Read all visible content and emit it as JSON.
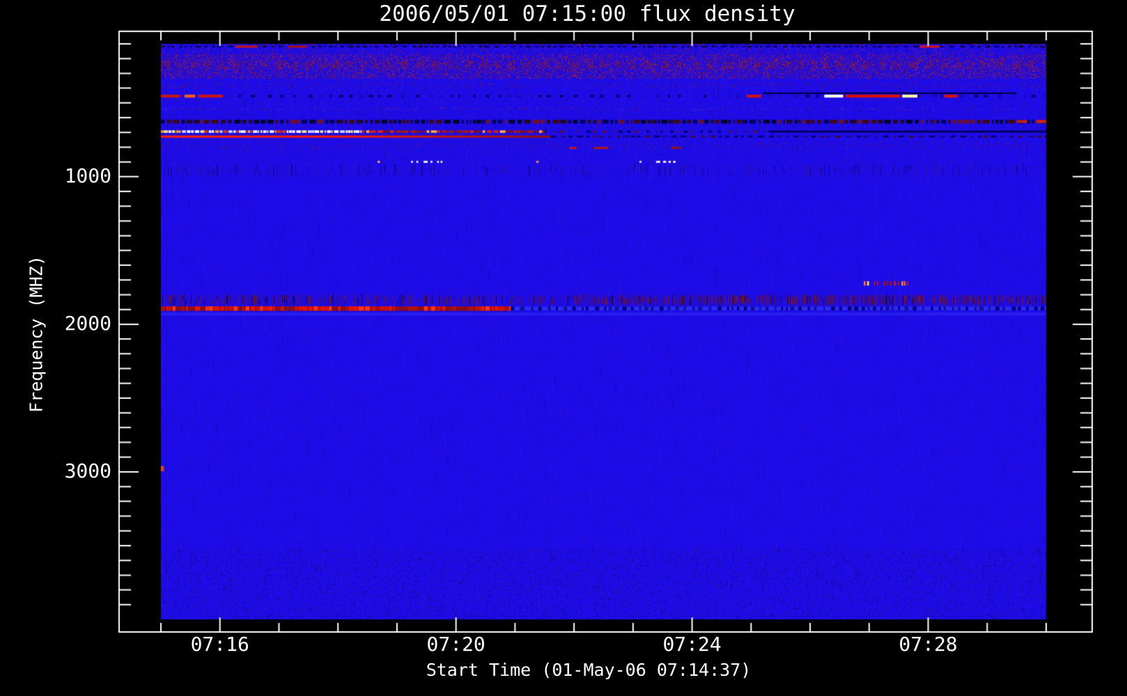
{
  "chart_data": {
    "type": "heatmap",
    "subtype": "radio-spectrogram",
    "title": "2006/05/01 07:15:00 flux density",
    "xlabel": "Start Time (01-May-06 07:14:37)",
    "ylabel": "Frequency (MHZ)",
    "legend": "none",
    "grid": false,
    "x_axis": {
      "t_min": 0,
      "t_max": 15,
      "unit": "minutes after 07:15:00",
      "start_time_label": "07:14:37",
      "minor_tick_every_min": 1,
      "major_ticks": [
        {
          "label": "07:16",
          "t": 1
        },
        {
          "label": "07:20",
          "t": 5
        },
        {
          "label": "07:24",
          "t": 9
        },
        {
          "label": "07:28",
          "t": 13
        }
      ]
    },
    "y_axis": {
      "min_mhz": 100,
      "max_mhz": 4000,
      "direction": "increasing-downward",
      "minor_tick_every_mhz": 100,
      "major_ticks": [
        {
          "label": "1000",
          "mhz": 1000
        },
        {
          "label": "2000",
          "mhz": 2000
        },
        {
          "label": "3000",
          "mhz": 3000
        }
      ]
    },
    "colors": {
      "page_background": "#000000",
      "frame": "#ffffff",
      "text": "#ffffff",
      "base_blue": "#1d0ce8",
      "bright_red": "#e61408",
      "dark_red": "#7c0e16",
      "orange": "#ff9822",
      "yellow": "#ffe874",
      "white_burst": "#fdfbe2",
      "dark_navy": "#000060",
      "purple": "#3a0dac"
    },
    "background": {
      "base": "#1d0ce8",
      "vstreak_count": 9000,
      "vstreak_colors": [
        "rgba(10,4,150,0.25)",
        "rgba(40,10,160,0.2)",
        "rgba(70,20,150,0.14)",
        "rgba(60,60,255,0.12)"
      ],
      "fleck_count": 26000,
      "fleck_colors": [
        "rgba(90,14,134,0.45)",
        "rgba(20,8,150,0.5)",
        "rgba(0,0,96,0.4)",
        "rgba(140,30,70,0.2)"
      ],
      "red_fleck_count": 240,
      "red_fleck_color": "rgba(200,40,24,0.8)",
      "top_noise": {
        "f_lo": 100,
        "f_hi": 1010,
        "count": 12000,
        "colors": [
          "rgba(140,26,60,0.35)",
          "rgba(58,13,172,0.4)",
          "rgba(20,8,150,0.45)",
          "rgba(168,32,32,0.3)"
        ]
      }
    },
    "features": [
      {
        "name": "top-edge-noise-row",
        "style": "speckle",
        "f_lo": 100,
        "f_hi": 114,
        "t_lo": 0,
        "t_hi": 15,
        "density": 0.3,
        "colors": [
          "#000050",
          "#b02020",
          "#28109c",
          "#0d0668"
        ]
      },
      {
        "name": "dark-dotted-line-118mhz",
        "style": "dash",
        "f_lo": 114,
        "f_hi": 124,
        "t_lo": 0,
        "t_hi": 15,
        "dash": [
          2,
          8
        ],
        "gap": [
          2,
          9
        ],
        "colors": [
          "#00004a",
          "#000078",
          "#0a0a24"
        ]
      },
      {
        "name": "red-dashes-120mhz",
        "style": "segments",
        "f_lo": 112,
        "f_hi": 126,
        "segs": [
          {
            "t0": 1.26,
            "t1": 1.64,
            "color": "#cc1816"
          },
          {
            "t0": 2.15,
            "t1": 2.48,
            "color": "#aa1414"
          },
          {
            "t0": 12.86,
            "t1": 13.19,
            "color": "#e61410"
          }
        ]
      },
      {
        "name": "speckle-row-140mhz",
        "style": "speckle",
        "f_lo": 128,
        "f_hi": 168,
        "t_lo": 0,
        "t_hi": 15,
        "density": 0.14,
        "colors": [
          "#a81c2c",
          "#3a0dac",
          "#150aa0"
        ]
      },
      {
        "name": "noise-band-180-330mhz",
        "style": "speckle",
        "f_lo": 170,
        "f_hi": 336,
        "t_lo": 0,
        "t_hi": 15,
        "density": 0.4,
        "colors": [
          "#8c1a3c",
          "#a82020",
          "#5a0e86",
          "#3a0dac",
          "#1408a0",
          "#cc2818",
          "#2a0dc0"
        ]
      },
      {
        "name": "block-row-240mhz",
        "style": "blocks",
        "f_lo": 218,
        "f_hi": 266,
        "t_lo": 0,
        "t_hi": 15,
        "block_w": [
          7,
          14
        ],
        "density": 0.55,
        "colors": [
          "#7a1644",
          "#8c1a3c",
          "#44108c"
        ]
      },
      {
        "name": "faint-speckle-385mhz",
        "style": "speckle",
        "f_lo": 362,
        "f_hi": 400,
        "t_lo": 0,
        "t_hi": 15,
        "density": 0.07,
        "colors": [
          "#981828",
          "#440da0"
        ]
      },
      {
        "name": "dark-line-435mhz-right",
        "style": "solid",
        "f_lo": 429,
        "f_hi": 440,
        "t_lo": 10.2,
        "t_hi": 14.5,
        "color": "#000050"
      },
      {
        "name": "sparse-dark-dashes-455mhz",
        "style": "dash",
        "f_lo": 446,
        "f_hi": 462,
        "t_lo": 0,
        "t_hi": 15,
        "dash": [
          2,
          6
        ],
        "gap": [
          7,
          20
        ],
        "colors": [
          "#000060",
          "#170bb0"
        ]
      },
      {
        "name": "interference-dashes-455mhz",
        "style": "segments",
        "f_lo": 444,
        "f_hi": 464,
        "segs": [
          {
            "t0": 0.0,
            "t1": 0.33,
            "color": "#c01616"
          },
          {
            "t0": 0.4,
            "t1": 0.58,
            "color": "#ff5a14"
          },
          {
            "t0": 0.63,
            "t1": 1.05,
            "color": "#cc1414"
          },
          {
            "t0": 9.93,
            "t1": 10.17,
            "color": "#cc1414"
          },
          {
            "t0": 11.24,
            "t1": 11.56,
            "color": "#fdfbe2"
          },
          {
            "t0": 11.6,
            "t1": 12.53,
            "color": "#d41010"
          },
          {
            "t0": 12.56,
            "t1": 12.82,
            "color": "#fdf6a6"
          },
          {
            "t0": 13.27,
            "t1": 13.5,
            "color": "#d41212"
          }
        ]
      },
      {
        "name": "faint-row-540mhz",
        "style": "speckle",
        "f_lo": 532,
        "f_hi": 552,
        "t_lo": 0,
        "t_hi": 15,
        "density": 0.12,
        "colors": [
          "#981830",
          "#2c109a",
          "#3636f0"
        ]
      },
      {
        "name": "dark-band-625mhz",
        "style": "dash",
        "f_lo": 614,
        "f_hi": 640,
        "t_lo": 0,
        "t_hi": 15,
        "dash": [
          2,
          10
        ],
        "gap": [
          1,
          4
        ],
        "colors": [
          "#000030",
          "#3c0818",
          "#701020",
          "#000060",
          "#200830"
        ]
      },
      {
        "name": "red-bits-625mhz-right",
        "style": "segments",
        "f_lo": 616,
        "f_hi": 636,
        "segs": [
          {
            "t0": 14.5,
            "t1": 14.68,
            "color": "#c42018"
          },
          {
            "t0": 14.84,
            "t1": 15.0,
            "color": "#d82414"
          }
        ]
      },
      {
        "name": "bright-line-695mhz-left",
        "style": "dash",
        "f_lo": 686,
        "f_hi": 703,
        "t_lo": 0,
        "t_hi": 3.4,
        "dash": [
          2,
          7
        ],
        "gap": [
          0,
          2
        ],
        "colors": [
          "#fdfce6",
          "#ffe874",
          "#ff9822",
          "#e63212",
          "#d2d2fa",
          "#ffffff"
        ]
      },
      {
        "name": "bright-line-695mhz-mid",
        "style": "dash",
        "f_lo": 686,
        "f_hi": 703,
        "t_lo": 3.4,
        "t_hi": 6.5,
        "dash": [
          3,
          9
        ],
        "gap": [
          0,
          3
        ],
        "colors": [
          "#dc2010",
          "#a81616",
          "#ffae3e",
          "#7c1022"
        ]
      },
      {
        "name": "bright-line-695mhz-fade",
        "style": "dash",
        "f_lo": 687,
        "f_hi": 702,
        "t_lo": 6.5,
        "t_hi": 10.3,
        "dash": [
          2,
          6
        ],
        "gap": [
          4,
          12
        ],
        "colors": [
          "#000070",
          "#26109a",
          "#5a1030"
        ]
      },
      {
        "name": "bright-line-695mhz-dark-right",
        "style": "solid",
        "f_lo": 688,
        "f_hi": 701,
        "t_lo": 10.3,
        "t_hi": 15,
        "color": "#000056"
      },
      {
        "name": "red-line-728mhz",
        "style": "gradient",
        "f_lo": 721,
        "f_hi": 736,
        "t_lo": 0,
        "t_hi": 6.6,
        "stops": [
          [
            0,
            "#ff1e08"
          ],
          [
            0.5,
            "#ee1808"
          ],
          [
            1,
            "#8c1018"
          ]
        ]
      },
      {
        "name": "red-line-728mhz-dark-right",
        "style": "dash",
        "f_lo": 722,
        "f_hi": 734,
        "t_lo": 6.6,
        "t_hi": 15,
        "dash": [
          3,
          9
        ],
        "gap": [
          3,
          9
        ],
        "colors": [
          "#000060",
          "#1e088c",
          "#460a20"
        ]
      },
      {
        "name": "faint-red-dots-790mhz",
        "style": "speckle",
        "f_lo": 772,
        "f_hi": 815,
        "t_lo": 0,
        "t_hi": 15,
        "density": 0.05,
        "colors": [
          "#981828",
          "#30109a"
        ]
      },
      {
        "name": "red-dashes-805mhz",
        "style": "segments",
        "f_lo": 798,
        "f_hi": 812,
        "segs": [
          {
            "t0": 6.92,
            "t1": 7.04,
            "color": "#c01818"
          },
          {
            "t0": 7.34,
            "t1": 7.58,
            "color": "#b41616"
          },
          {
            "t0": 8.64,
            "t1": 8.81,
            "color": "#921414"
          }
        ]
      },
      {
        "name": "white-dots-900mhz",
        "style": "segments",
        "f_lo": 893,
        "f_hi": 906,
        "segs": [
          {
            "t0": 3.67,
            "t1": 3.71,
            "color": "#ffb052"
          },
          {
            "t0": 4.24,
            "t1": 4.27,
            "color": "#fdfde2"
          },
          {
            "t0": 4.33,
            "t1": 4.36,
            "color": "#fdfde2"
          },
          {
            "t0": 4.45,
            "t1": 4.52,
            "color": "#ffffff"
          },
          {
            "t0": 4.57,
            "t1": 4.6,
            "color": "#fdfde2"
          },
          {
            "t0": 4.68,
            "t1": 4.71,
            "color": "#ffffff"
          },
          {
            "t0": 4.74,
            "t1": 4.77,
            "color": "#fdfde2"
          },
          {
            "t0": 6.36,
            "t1": 6.4,
            "color": "#ff9832"
          },
          {
            "t0": 8.11,
            "t1": 8.14,
            "color": "#fdfde8"
          },
          {
            "t0": 8.39,
            "t1": 8.46,
            "color": "#fbf6d0"
          },
          {
            "t0": 8.51,
            "t1": 8.56,
            "color": "#fdfde8"
          },
          {
            "t0": 8.6,
            "t1": 8.64,
            "color": "#fbefbe"
          },
          {
            "t0": 8.68,
            "t1": 8.72,
            "color": "#ffffff"
          }
        ]
      },
      {
        "name": "texture-950mhz",
        "style": "vstreaks",
        "f_lo": 915,
        "f_hi": 1000,
        "t_lo": 0,
        "t_hi": 15,
        "density": 0.18,
        "colors": [
          "#10079c",
          "#2e0da8"
        ]
      },
      {
        "name": "red-dots-1720mhz",
        "style": "dash",
        "f_lo": 1708,
        "f_hi": 1738,
        "t_lo": 11.91,
        "t_hi": 12.66,
        "dash": [
          1,
          3
        ],
        "gap": [
          1,
          4
        ],
        "colors": [
          "#cc1810",
          "#ff8822",
          "#ffd242",
          "#a81010",
          "#1d0ce8"
        ]
      },
      {
        "name": "streak-band-1835mhz",
        "style": "vstreaks",
        "f_lo": 1798,
        "f_hi": 1873,
        "t_lo": 0,
        "t_hi": 15,
        "density": 0.6,
        "colors": [
          "#0d0668",
          "#3a0dac",
          "#53105e",
          "#661330",
          "#170bd2"
        ]
      },
      {
        "name": "streak-band-1835mhz-right-red",
        "style": "vstreaks",
        "f_lo": 1798,
        "f_hi": 1873,
        "t_lo": 7,
        "t_hi": 15,
        "density": 0.35,
        "colors": [
          "#5c1032",
          "#78123e",
          "#3c0e70"
        ]
      },
      {
        "name": "burst-base-1890mhz",
        "style": "solid",
        "f_lo": 1878,
        "f_hi": 1908,
        "t_lo": 0,
        "t_hi": 5.93,
        "color": "#7c0e16"
      },
      {
        "name": "burst-red-1890mhz",
        "style": "dash",
        "f_lo": 1878,
        "f_hi": 1908,
        "t_lo": 0,
        "t_hi": 5.93,
        "dash": [
          2,
          8
        ],
        "gap": [
          0,
          2
        ],
        "colors": [
          "#e61408",
          "#b01010",
          "#8c0f20",
          "#ff3412",
          "#cc1208"
        ]
      },
      {
        "name": "channel-blue-1890mhz",
        "style": "solid",
        "f_lo": 1880,
        "f_hi": 1906,
        "t_lo": 5.93,
        "t_hi": 15,
        "color": "#2a2af8"
      },
      {
        "name": "channel-dark-dashes-1890mhz",
        "style": "dash",
        "f_lo": 1880,
        "f_hi": 1906,
        "t_lo": 5.93,
        "t_hi": 15,
        "dash": [
          2,
          6
        ],
        "gap": [
          3,
          10
        ],
        "colors": [
          "#000078",
          "#101092"
        ]
      },
      {
        "name": "light-row-1928mhz",
        "style": "tint",
        "f_lo": 1920,
        "f_hi": 1940,
        "t_lo": 0,
        "t_hi": 15,
        "color": "rgba(64,64,255,0.35)"
      },
      {
        "name": "red-tick-2985mhz",
        "style": "segments",
        "f_lo": 2960,
        "f_hi": 2996,
        "segs": [
          {
            "t0": 0,
            "t1": 0.05,
            "color": "#e04818"
          }
        ]
      },
      {
        "name": "bottom-mottle",
        "style": "speckle",
        "f_lo": 3520,
        "f_hi": 3996,
        "t_lo": 0,
        "t_hi": 15,
        "density": 0.09,
        "colors": [
          "#150890",
          "#3a0dac",
          "#0d0668"
        ]
      }
    ]
  }
}
